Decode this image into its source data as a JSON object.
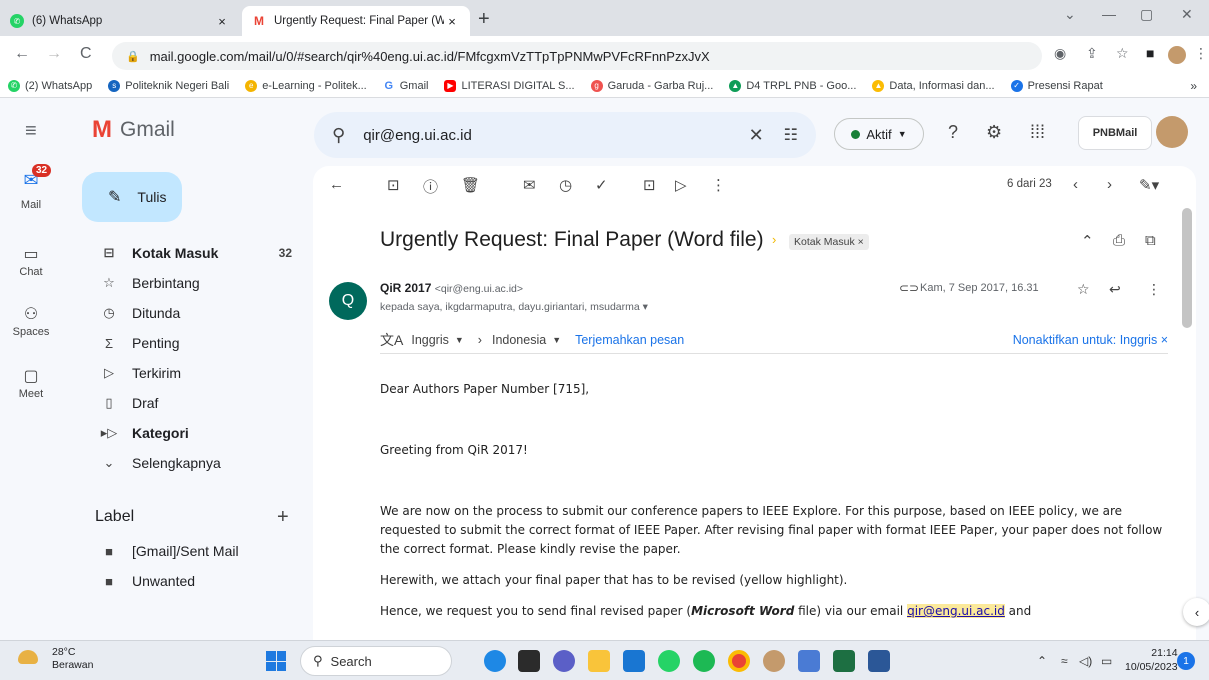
{
  "browser": {
    "tabs": [
      {
        "label": "(6) WhatsApp",
        "active": false,
        "icon": "whatsapp-icon"
      },
      {
        "label": "Urgently Request: Final Paper (W",
        "active": true,
        "icon": "gmail-icon"
      }
    ],
    "url": "mail.google.com/mail/u/0/#search/qir%40eng.ui.ac.id/FMfcgxmVzTTpTpPNMwPVFcRFnnPzxJvX",
    "bookmarks": [
      {
        "label": "(2) WhatsApp",
        "color": "#25d366"
      },
      {
        "label": "Politeknik Negeri Bali",
        "color": "#1565c0"
      },
      {
        "label": "e-Learning - Politek...",
        "color": "#f4b400"
      },
      {
        "label": "Gmail",
        "color": "#4285f4"
      },
      {
        "label": "LITERASI DIGITAL S...",
        "color": "#ff0000"
      },
      {
        "label": "Garuda - Garba Ruj...",
        "color": "#ef5350"
      },
      {
        "label": "D4 TRPL PNB - Goo...",
        "color": "#0f9d58"
      },
      {
        "label": "Data, Informasi dan...",
        "color": "#fbbc04"
      },
      {
        "label": "Presensi Rapat",
        "color": "#1a73e8"
      }
    ],
    "more": "»"
  },
  "gmail": {
    "brand": "Gmail",
    "search_query": "qir@eng.ui.ac.id",
    "status": "Aktif",
    "pnb_logo": "PNBMail",
    "rail": [
      {
        "label": "Mail",
        "badge": "32"
      },
      {
        "label": "Chat"
      },
      {
        "label": "Spaces"
      },
      {
        "label": "Meet"
      }
    ],
    "compose": "Tulis",
    "folders": [
      {
        "label": "Kotak Masuk",
        "count": "32",
        "icon": "inbox-icon",
        "bold": true
      },
      {
        "label": "Berbintang",
        "icon": "star-icon"
      },
      {
        "label": "Ditunda",
        "icon": "clock-icon"
      },
      {
        "label": "Penting",
        "icon": "important-icon"
      },
      {
        "label": "Terkirim",
        "icon": "send-icon"
      },
      {
        "label": "Draf",
        "icon": "draft-icon"
      },
      {
        "label": "Kategori",
        "icon": "label-outline-icon",
        "bold": true
      },
      {
        "label": "Selengkapnya",
        "icon": "chevron-down-icon"
      }
    ],
    "labels_title": "Label",
    "labels": [
      "[Gmail]/Sent Mail",
      "Unwanted"
    ],
    "pager": "6 dari 23",
    "email": {
      "subject": "Urgently Request: Final Paper (Word file)",
      "chip": "Kotak Masuk",
      "sender_initial": "Q",
      "sender_name": "QiR 2017",
      "sender_email": "<qir@eng.ui.ac.id>",
      "recipients": "kepada saya, ikgdarmaputra, dayu.giriantari, msudarma",
      "date": "Kam, 7 Sep 2017, 16.31",
      "translate": {
        "from": "Inggris",
        "to": "Indonesia",
        "translate_link": "Terjemahkan pesan",
        "disable": "Nonaktifkan untuk: Inggris"
      },
      "body": {
        "greeting": "Dear Authors Paper Number [715],",
        "line2": "Greeting from QiR 2017!",
        "para1": "We are now on the process to submit our conference papers to IEEE Explore. For this purpose, based on IEEE policy, we are requested to submit the correct format of IEEE Paper. After revising final paper with format IEEE Paper, your paper does not follow the correct format. Please kindly revise the paper.",
        "para2": "Herewith, we attach your final paper that has to be revised (yellow highlight).",
        "para3_a": "Hence, we request you to send final revised paper (",
        "para3_b": "Microsoft Word",
        "para3_c": " file) via our email ",
        "para3_link": "qir@eng.ui.ac.id",
        "para3_d": " and"
      }
    }
  },
  "taskbar": {
    "temp": "28°C",
    "weather": "Berawan",
    "search": "Search",
    "time": "21:14",
    "date": "10/05/2023",
    "notifications": "1"
  }
}
